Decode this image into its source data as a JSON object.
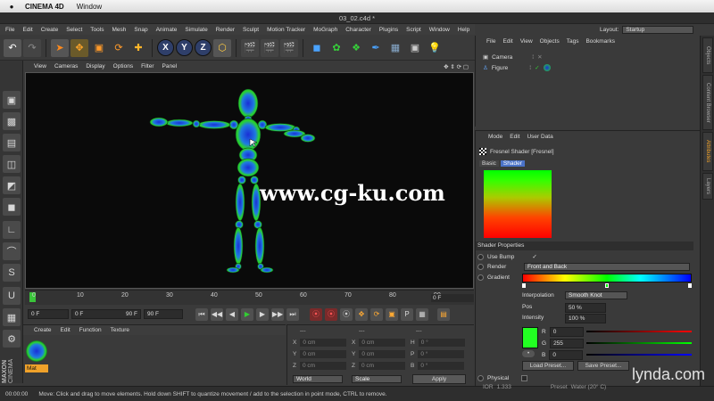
{
  "mac": {
    "apple": "",
    "app_name": "CINEMA 4D",
    "window_menu": "Window"
  },
  "window_title": "03_02.c4d *",
  "menu": [
    "File",
    "Edit",
    "Create",
    "Select",
    "Tools",
    "Mesh",
    "Snap",
    "Animate",
    "Simulate",
    "Render",
    "Sculpt",
    "Motion Tracker",
    "MoGraph",
    "Character",
    "Plugins",
    "Script",
    "Window",
    "Help"
  ],
  "layout": {
    "label": "Layout:",
    "value": "Startup"
  },
  "toolbar": {
    "axis_x": "X",
    "axis_y": "Y",
    "axis_z": "Z"
  },
  "viewport_menu": [
    "View",
    "Cameras",
    "Display",
    "Options",
    "Filter",
    "Panel"
  ],
  "watermark": "www.cg-ku.com",
  "timeline": {
    "ticks": [
      "0",
      "10",
      "20",
      "30",
      "40",
      "50",
      "60",
      "70",
      "80",
      "90"
    ],
    "end_field": "0 F"
  },
  "transport": {
    "current_frame": "0 F",
    "min_frame": "0 F",
    "range_end": "90 F",
    "max_frame": "90 F"
  },
  "material_panel": {
    "menu": [
      "Create",
      "Edit",
      "Function",
      "Texture"
    ],
    "material_name": "Mat"
  },
  "coords": {
    "rows": [
      {
        "a": "X",
        "av": "0 cm",
        "b": "X",
        "bv": "0 cm",
        "c": "H",
        "cv": "0 °"
      },
      {
        "a": "Y",
        "av": "0 cm",
        "b": "Y",
        "bv": "0 cm",
        "c": "P",
        "cv": "0 °"
      },
      {
        "a": "Z",
        "av": "0 cm",
        "b": "Z",
        "bv": "0 cm",
        "c": "B",
        "cv": "0 °"
      }
    ],
    "dash1": "---",
    "dash2": "---",
    "dash3": "---",
    "world": "World",
    "scale": "Scale",
    "apply": "Apply"
  },
  "status": {
    "time": "00:00:00",
    "message": "Move: Click and drag to move elements. Hold down SHIFT to quantize movement / add to the selection in point mode, CTRL to remove."
  },
  "object_manager": {
    "menu": [
      "File",
      "Edit",
      "View",
      "Objects",
      "Tags",
      "Bookmarks"
    ],
    "objects": [
      {
        "name": "Camera"
      },
      {
        "name": "Figure"
      }
    ]
  },
  "attributes": {
    "menu": [
      "Mode",
      "Edit",
      "User Data"
    ],
    "title": "Fresnel Shader [Fresnel]",
    "tabs": [
      "Basic",
      "Shader"
    ],
    "section": "Shader Properties",
    "use_bump_label": "Use Bump",
    "use_bump_value": "✓",
    "render_label": "Render",
    "render_value": "Front and Back",
    "gradient_label": "Gradient",
    "interpolation_label": "Interpolation",
    "interpolation_value": "Smooth Knot",
    "pos_label": "Pos",
    "pos_value": "50 %",
    "intensity_label": "Intensity",
    "intensity_value": "100 %",
    "r_label": "R",
    "r_value": "0",
    "g_label": "G",
    "g_value": "255",
    "b_label": "B",
    "b_value": "0",
    "load_preset": "Load Preset...",
    "save_preset": "Save Preset...",
    "physical_label": "Physical",
    "ior_label": "IOR",
    "ior_value": "1.333",
    "preset_label": "Preset",
    "preset_value": "Water (20° C)",
    "swatch_color": "#22ff22"
  },
  "side_tabs": [
    "Objects",
    "Content Browser",
    "Attributes",
    "Layers"
  ],
  "brand": {
    "logo": "lynda.com",
    "maxon": "MAXON",
    "cinema": "CINEMA"
  }
}
